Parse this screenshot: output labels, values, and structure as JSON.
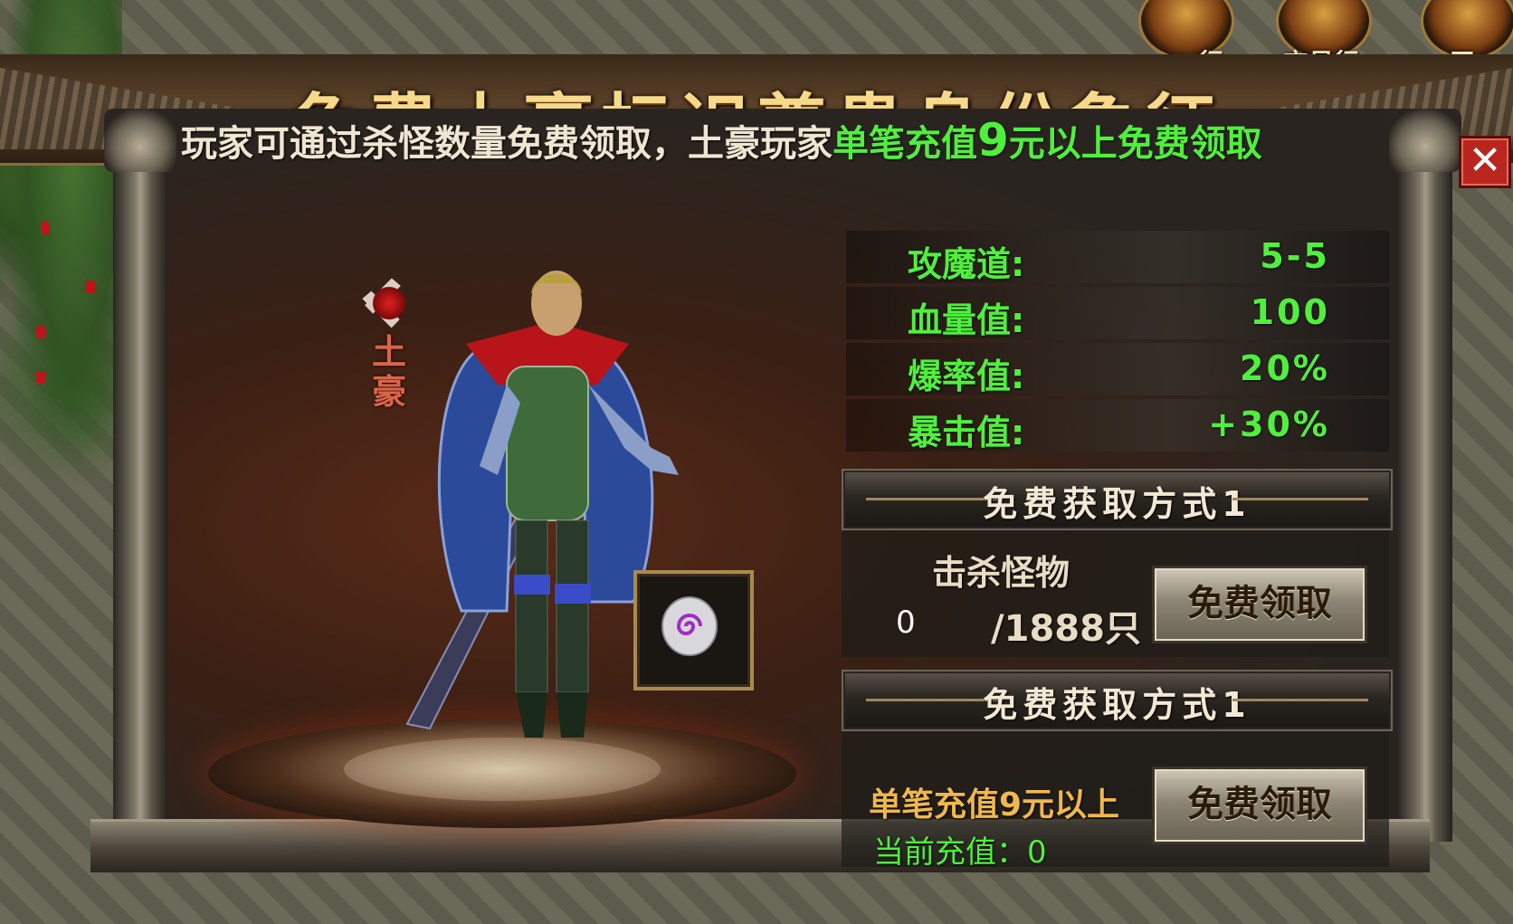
{
  "window": {
    "title": "免费土豪标识尊贵身份象征"
  },
  "top_menu": {
    "items": [
      {
        "label": "行",
        "icon": "temple-icon"
      },
      {
        "label": "交易行",
        "icon": "yin-yang-icon"
      },
      {
        "label": "王",
        "icon": "crown-icon"
      }
    ]
  },
  "subtitle": {
    "prefix": "玩家可通过杀怪数量免费领取，土豪玩家",
    "highlight_before": "单笔充值",
    "highlight_amount": "9",
    "highlight_after": "元以上免费领取"
  },
  "close_button": {
    "label": "✕"
  },
  "character": {
    "title_badge": {
      "line1": "土",
      "line2": "豪"
    }
  },
  "stats": [
    {
      "key": "攻魔道:",
      "value": "5-5"
    },
    {
      "key": "血量值:",
      "value": "100"
    },
    {
      "key": "爆率值:",
      "value": "20%"
    },
    {
      "key": "暴击值:",
      "value": "+30%"
    }
  ],
  "way1": {
    "header": "免费获取方式1",
    "kill_label": "击杀怪物",
    "kill_current": "0",
    "kill_total": "/1888只",
    "button": "免费领取"
  },
  "way2": {
    "header": "免费获取方式1",
    "recharge_label": "单笔充值9元以上",
    "current_label": "当前充值：0",
    "button": "免费领取"
  },
  "colors": {
    "accent_green": "#4ff03c",
    "title_gold": "#f6d98a",
    "close_red": "#b8261e",
    "recharge_orange": "#f0b84a"
  }
}
